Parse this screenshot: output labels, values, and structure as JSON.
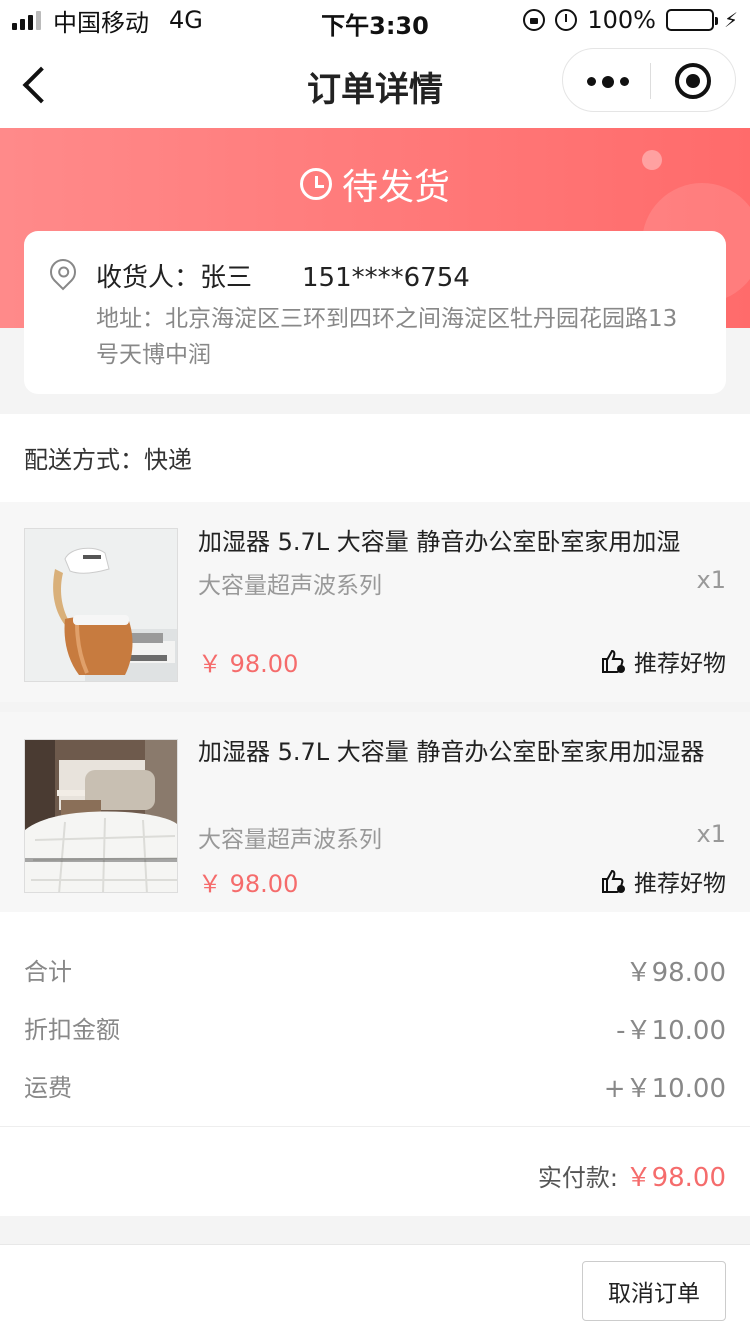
{
  "status_bar": {
    "carrier": "中国移动",
    "network": "4G",
    "time": "下午3:30",
    "battery": "100%"
  },
  "nav": {
    "title": "订单详情"
  },
  "order": {
    "status": "待发货"
  },
  "address": {
    "receiver": "收货人：张三",
    "phone": "151****6754",
    "detail": "地址：北京海淀区三环到四环之间海淀区牡丹园花园路13号天博中润"
  },
  "delivery": {
    "text": "配送方式：快递"
  },
  "products": [
    {
      "name": "加湿器 5.7L 大容量 静音办公室卧室家用加湿",
      "spec": "大容量超声波系列",
      "qty": "x1",
      "price": "￥ 98.00",
      "recommend": "推荐好物"
    },
    {
      "name": "加湿器 5.7L 大容量 静音办公室卧室家用加湿器",
      "spec": "大容量超声波系列",
      "qty": "x1",
      "price": "￥ 98.00",
      "recommend": "推荐好物"
    }
  ],
  "summary": {
    "total_label": "合计",
    "total_value": "￥98.00",
    "discount_label": "折扣金额",
    "discount_value": "-￥10.00",
    "shipping_label": "运费",
    "shipping_value": "+￥10.00",
    "paid_label": "实付款:",
    "paid_value": "￥98.00"
  },
  "actions": {
    "cancel": "取消订单"
  },
  "colors": {
    "accent": "#f56c6c",
    "banner_start": "#ff8a8a",
    "banner_end": "#ff6b6b"
  }
}
